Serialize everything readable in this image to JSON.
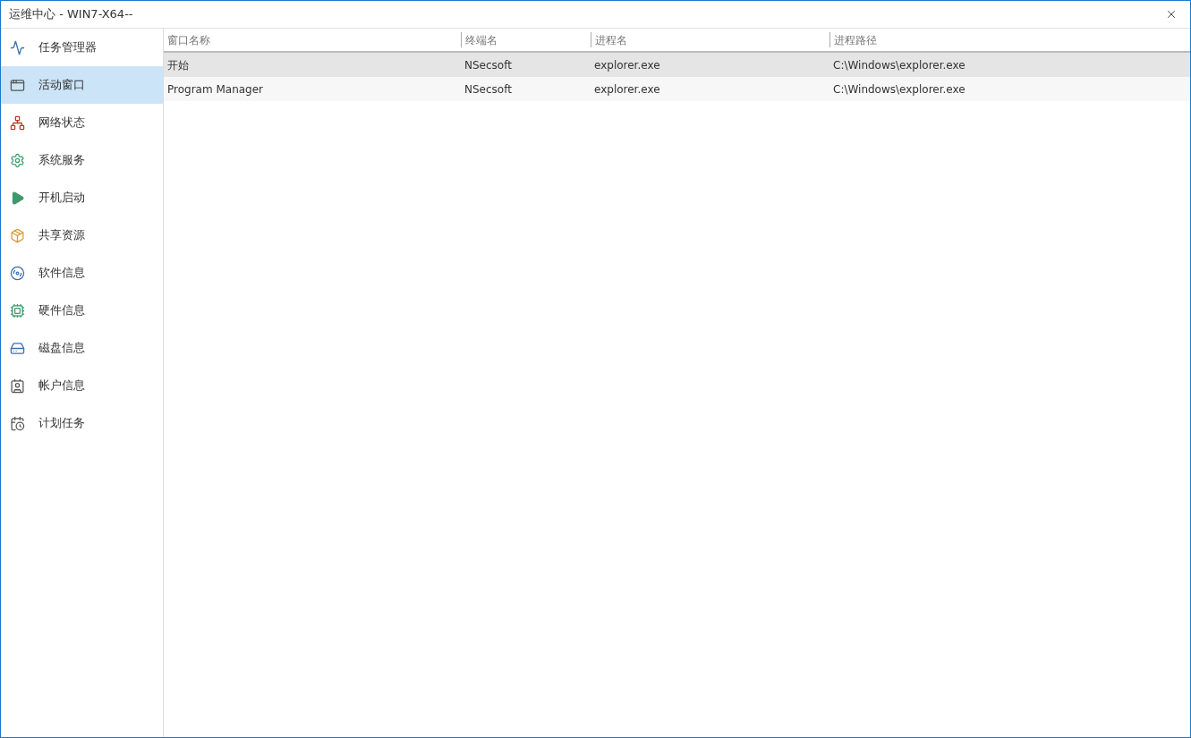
{
  "window": {
    "title": "运维中心 - WIN7-X64--"
  },
  "sidebar": {
    "items": [
      {
        "label": "任务管理器",
        "selected": false
      },
      {
        "label": "活动窗口",
        "selected": true
      },
      {
        "label": "网络状态",
        "selected": false
      },
      {
        "label": "系统服务",
        "selected": false
      },
      {
        "label": "开机启动",
        "selected": false
      },
      {
        "label": "共享资源",
        "selected": false
      },
      {
        "label": "软件信息",
        "selected": false
      },
      {
        "label": "硬件信息",
        "selected": false
      },
      {
        "label": "磁盘信息",
        "selected": false
      },
      {
        "label": "帐户信息",
        "selected": false
      },
      {
        "label": "计划任务",
        "selected": false
      }
    ]
  },
  "table": {
    "columns": [
      "窗口名称",
      "终端名",
      "进程名",
      "进程路径"
    ],
    "rows": [
      {
        "cells": [
          "开始",
          "NSecsoft",
          "explorer.exe",
          "C:\\Windows\\explorer.exe"
        ],
        "selected": true
      },
      {
        "cells": [
          "Program Manager",
          "NSecsoft",
          "explorer.exe",
          "C:\\Windows\\explorer.exe"
        ],
        "selected": false
      }
    ]
  }
}
